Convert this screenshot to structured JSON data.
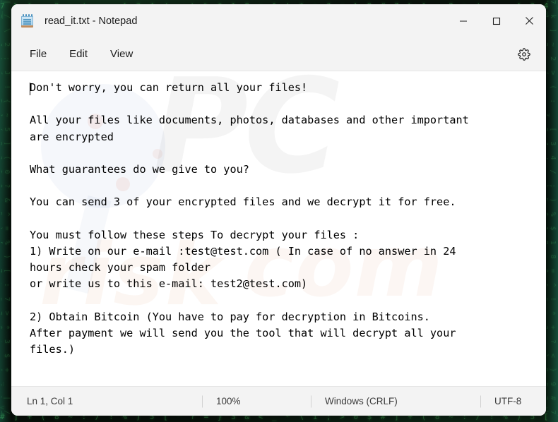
{
  "desktop": {
    "background_color": "#060c06",
    "accent_color": "#2f7d3e",
    "matrix_rows": [
      "7 k ] ~ 2 > ( : _ [ 3 4 / ; ) % $ 1 8 = ^ ! * + ? < } 9 #",
      "| / \\ 2 ; J ! { ~ 5 ] ( 0 ? & ^ = % ) [ : 7 > * 3 $ + _",
      "< 6 ) ; ^ 1 } [ # / % : ~ ? 9 ( = & ] * 4 ! > _ 2 + $ \\",
      "# ] + ( 8 ~ : / ! % ) 5 [ ^ ? = } 3 & < _ * \\ 1 ; > 0 $"
    ]
  },
  "window": {
    "title": "read_it.txt - Notepad",
    "icon": "notepad-icon",
    "controls": {
      "minimize": "minimize-icon",
      "maximize": "maximize-icon",
      "close": "close-icon"
    }
  },
  "menu": {
    "items": [
      {
        "label": "File"
      },
      {
        "label": "Edit"
      },
      {
        "label": "View"
      }
    ],
    "settings_icon": "gear-icon"
  },
  "editor": {
    "content": "Don't worry, you can return all your files!\n\nAll your files like documents, photos, databases and other important\nare encrypted\n\nWhat guarantees do we give to you?\n\nYou can send 3 of your encrypted files and we decrypt it for free.\n\nYou must follow these steps To decrypt your files :\n1) Write on our e-mail :test@test.com ( In case of no answer in 24\nhours check your spam folder\nor write us to this e-mail: test2@test.com)\n\n2) Obtain Bitcoin (You have to pay for decryption in Bitcoins.\nAfter payment we will send you the tool that will decrypt all your\nfiles.)",
    "emails": [
      "test@test.com",
      "test2@test.com"
    ],
    "watermarks": {
      "brand": "PC",
      "word_left": "risk",
      "word_right": "com"
    }
  },
  "status_bar": {
    "position": "Ln 1, Col 1",
    "zoom": "100%",
    "line_ending": "Windows (CRLF)",
    "encoding": "UTF-8"
  }
}
